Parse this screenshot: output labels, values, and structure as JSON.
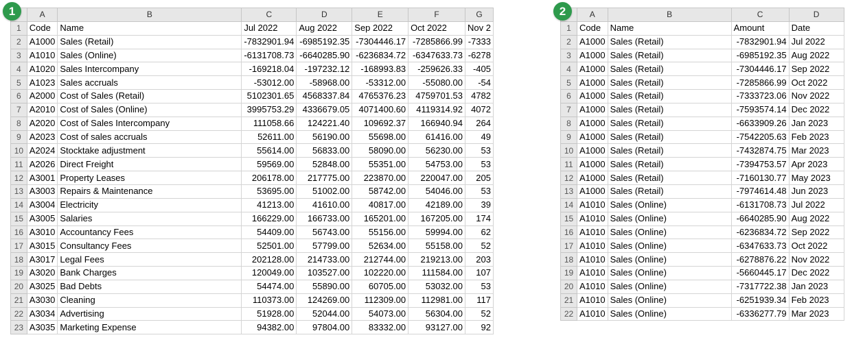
{
  "badge1": "1",
  "badge2": "2",
  "sheet1": {
    "col_letters": [
      "A",
      "B",
      "C",
      "D",
      "E",
      "F",
      "G"
    ],
    "rows": [
      [
        "Code",
        "Name",
        "Jul 2022",
        "Aug 2022",
        "Sep 2022",
        "Oct 2022",
        "Nov 2"
      ],
      [
        "A1000",
        "Sales (Retail)",
        "-7832901.94",
        "-6985192.35",
        "-7304446.17",
        "-7285866.99",
        "-7333"
      ],
      [
        "A1010",
        "Sales (Online)",
        "-6131708.73",
        "-6640285.90",
        "-6236834.72",
        "-6347633.73",
        "-6278"
      ],
      [
        "A1020",
        "Sales Intercompany",
        "-169218.04",
        "-197232.12",
        "-168993.83",
        "-259626.33",
        "-405"
      ],
      [
        "A1023",
        "Sales accruals",
        "-53012.00",
        "-58968.00",
        "-53312.00",
        "-55080.00",
        "-54"
      ],
      [
        "A2000",
        "Cost of Sales (Retail)",
        "5102301.65",
        "4568337.84",
        "4765376.23",
        "4759701.53",
        "4782"
      ],
      [
        "A2010",
        "Cost of Sales (Online)",
        "3995753.29",
        "4336679.05",
        "4071400.60",
        "4119314.92",
        "4072"
      ],
      [
        "A2020",
        "Cost of Sales Intercompany",
        "111058.66",
        "124221.40",
        "109692.37",
        "166940.94",
        "264"
      ],
      [
        "A2023",
        "Cost of sales accruals",
        "52611.00",
        "56190.00",
        "55698.00",
        "61416.00",
        "49"
      ],
      [
        "A2024",
        "Stocktake adjustment",
        "55614.00",
        "56833.00",
        "58090.00",
        "56230.00",
        "53"
      ],
      [
        "A2026",
        "Direct Freight",
        "59569.00",
        "52848.00",
        "55351.00",
        "54753.00",
        "53"
      ],
      [
        "A3001",
        "Property Leases",
        "206178.00",
        "217775.00",
        "223870.00",
        "220047.00",
        "205"
      ],
      [
        "A3003",
        "Repairs & Maintenance",
        "53695.00",
        "51002.00",
        "58742.00",
        "54046.00",
        "53"
      ],
      [
        "A3004",
        "Electricity",
        "41213.00",
        "41610.00",
        "40817.00",
        "42189.00",
        "39"
      ],
      [
        "A3005",
        "Salaries",
        "166229.00",
        "166733.00",
        "165201.00",
        "167205.00",
        "174"
      ],
      [
        "A3010",
        "Accountancy Fees",
        "54409.00",
        "56743.00",
        "55156.00",
        "59994.00",
        "62"
      ],
      [
        "A3015",
        "Consultancy Fees",
        "52501.00",
        "57799.00",
        "52634.00",
        "55158.00",
        "52"
      ],
      [
        "A3017",
        "Legal Fees",
        "202128.00",
        "214733.00",
        "212744.00",
        "219213.00",
        "203"
      ],
      [
        "A3020",
        "Bank Charges",
        "120049.00",
        "103527.00",
        "102220.00",
        "111584.00",
        "107"
      ],
      [
        "A3025",
        "Bad Debts",
        "54474.00",
        "55890.00",
        "60705.00",
        "53032.00",
        "53"
      ],
      [
        "A3030",
        "Cleaning",
        "110373.00",
        "124269.00",
        "112309.00",
        "112981.00",
        "117"
      ],
      [
        "A3034",
        "Advertising",
        "51928.00",
        "52044.00",
        "54073.00",
        "56304.00",
        "52"
      ],
      [
        "A3035",
        "Marketing Expense",
        "94382.00",
        "97804.00",
        "83332.00",
        "93127.00",
        "92"
      ]
    ]
  },
  "sheet2": {
    "col_letters": [
      "A",
      "B",
      "C",
      "D"
    ],
    "rows": [
      [
        "Code",
        "Name",
        "Amount",
        "Date"
      ],
      [
        "A1000",
        "Sales (Retail)",
        "-7832901.94",
        "Jul 2022"
      ],
      [
        "A1000",
        "Sales (Retail)",
        "-6985192.35",
        "Aug 2022"
      ],
      [
        "A1000",
        "Sales (Retail)",
        "-7304446.17",
        "Sep 2022"
      ],
      [
        "A1000",
        "Sales (Retail)",
        "-7285866.99",
        "Oct 2022"
      ],
      [
        "A1000",
        "Sales (Retail)",
        "-7333723.06",
        "Nov 2022"
      ],
      [
        "A1000",
        "Sales (Retail)",
        "-7593574.14",
        "Dec 2022"
      ],
      [
        "A1000",
        "Sales (Retail)",
        "-6633909.26",
        "Jan 2023"
      ],
      [
        "A1000",
        "Sales (Retail)",
        "-7542205.63",
        "Feb 2023"
      ],
      [
        "A1000",
        "Sales (Retail)",
        "-7432874.75",
        "Mar 2023"
      ],
      [
        "A1000",
        "Sales (Retail)",
        "-7394753.57",
        "Apr 2023"
      ],
      [
        "A1000",
        "Sales (Retail)",
        "-7160130.77",
        "May 2023"
      ],
      [
        "A1000",
        "Sales (Retail)",
        "-7974614.48",
        "Jun 2023"
      ],
      [
        "A1010",
        "Sales (Online)",
        "-6131708.73",
        "Jul 2022"
      ],
      [
        "A1010",
        "Sales (Online)",
        "-6640285.90",
        "Aug 2022"
      ],
      [
        "A1010",
        "Sales (Online)",
        "-6236834.72",
        "Sep 2022"
      ],
      [
        "A1010",
        "Sales (Online)",
        "-6347633.73",
        "Oct 2022"
      ],
      [
        "A1010",
        "Sales (Online)",
        "-6278876.22",
        "Nov 2022"
      ],
      [
        "A1010",
        "Sales (Online)",
        "-5660445.17",
        "Dec 2022"
      ],
      [
        "A1010",
        "Sales (Online)",
        "-7317722.38",
        "Jan 2023"
      ],
      [
        "A1010",
        "Sales (Online)",
        "-6251939.34",
        "Feb 2023"
      ],
      [
        "A1010",
        "Sales (Online)",
        "-6336277.79",
        "Mar 2023"
      ]
    ]
  }
}
